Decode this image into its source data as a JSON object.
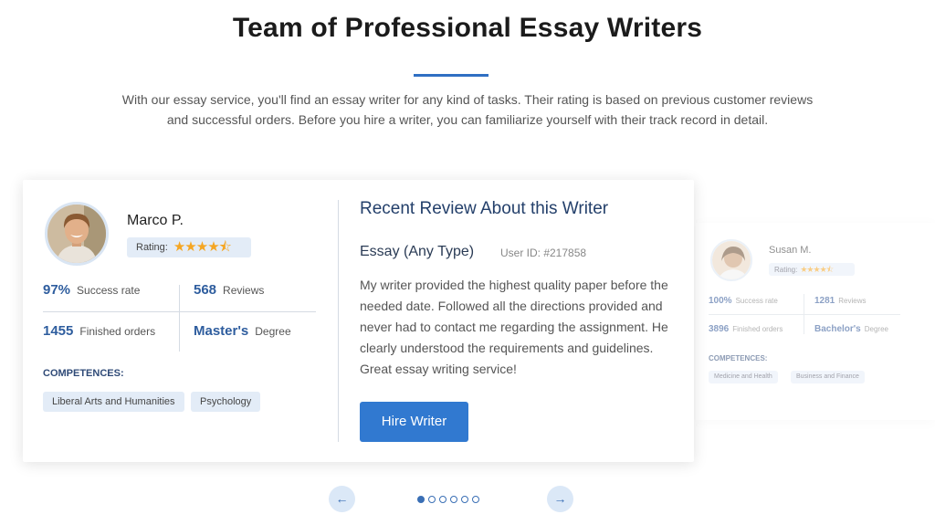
{
  "header": {
    "title": "Team of Professional Essay Writers",
    "intro": "With our essay service, you'll find an essay writer for any kind of tasks. Their rating is based on previous customer reviews and successful orders. Before you hire a writer, you can familiarize yourself with their track record in detail."
  },
  "main_card": {
    "writer": {
      "name": "Marco P.",
      "rating_label": "Rating:",
      "rating_stars": "★★★★⯪",
      "rating_value": 4.5
    },
    "stats": {
      "success_value": "97%",
      "success_label": "Success rate",
      "reviews_value": "568",
      "reviews_label": "Reviews",
      "orders_value": "1455",
      "orders_label": "Finished orders",
      "degree_value": "Master's",
      "degree_label": "Degree"
    },
    "competences_title": "COMPETENCES:",
    "competences": [
      "Liberal Arts and Humanities",
      "Psychology"
    ],
    "review": {
      "heading": "Recent Review About this Writer",
      "type": "Essay (Any Type)",
      "user_id": "User ID: #217858",
      "text": "My writer provided the highest quality paper before the needed date. Followed all the directions provided and never had to contact me regarding the assignment. He clearly understood the requirements and guidelines. Great essay writing service!"
    },
    "hire_button": "Hire Writer"
  },
  "side_card": {
    "name": "Susan M.",
    "rating_label": "Rating:",
    "rating_stars": "★★★★⯪",
    "success_value": "100%",
    "success_label": "Success rate",
    "reviews_value": "1281",
    "reviews_label": "Reviews",
    "orders_value": "3896",
    "orders_label": "Finished orders",
    "degree_value": "Bachelor's",
    "degree_label": "Degree",
    "competences_title": "COMPETENCES:",
    "competences": [
      "Medicine and Health",
      "Business and Finance"
    ]
  },
  "pager": {
    "prev_icon": "←",
    "next_icon": "→",
    "active_index": 0,
    "total": 6
  },
  "colors": {
    "accent": "#3179d0",
    "heading_blue": "#24406b",
    "star": "#f5a623"
  }
}
